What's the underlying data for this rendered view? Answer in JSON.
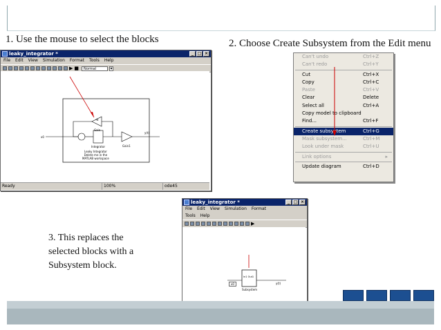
{
  "steps": {
    "step1": "1. Use the mouse to select the blocks",
    "step2": "2. Choose Create Subsystem from the Edit menu",
    "step3_line1": "3. This replaces the",
    "step3_line2": "selected blocks with a",
    "step3_line3": "Subsystem block."
  },
  "window1": {
    "title": "leaky_integrator *",
    "menu": [
      "File",
      "Edit",
      "View",
      "Simulation",
      "Format",
      "Tools",
      "Help"
    ],
    "sim_mode": "Normal",
    "status": {
      "left": "Ready",
      "zoom": "100%",
      "solver": "ode45"
    },
    "blocks": {
      "gain_value": "-K-",
      "gain_label": "Gain",
      "integrator_label": "Integrator",
      "gain1_label": "Gain1",
      "in_label": "x0",
      "out_label": "y(t)",
      "note_line1": "Leaky Integrator",
      "note_line2": "Delete me in the",
      "note_line3": "MATLAB workspace"
    }
  },
  "edit_menu": {
    "items": [
      {
        "label": "Can't undo",
        "shortcut": "Ctrl+Z",
        "state": "disabled"
      },
      {
        "label": "Can't redo",
        "shortcut": "Ctrl+Y",
        "state": "disabled"
      },
      {
        "sep": true
      },
      {
        "label": "Cut",
        "shortcut": "Ctrl+X",
        "state": "enabled"
      },
      {
        "label": "Copy",
        "shortcut": "Ctrl+C",
        "state": "enabled"
      },
      {
        "label": "Paste",
        "shortcut": "Ctrl+V",
        "state": "disabled"
      },
      {
        "label": "Clear",
        "shortcut": "Delete",
        "state": "enabled"
      },
      {
        "label": "Select all",
        "shortcut": "Ctrl+A",
        "state": "enabled"
      },
      {
        "label": "Copy model to clipboard",
        "shortcut": "",
        "state": "enabled"
      },
      {
        "label": "Find...",
        "shortcut": "Ctrl+F",
        "state": "enabled"
      },
      {
        "sep": true
      },
      {
        "label": "Create subsystem",
        "shortcut": "Ctrl+G",
        "state": "selected"
      },
      {
        "label": "Mask subsystem...",
        "shortcut": "Ctrl+M",
        "state": "disabled"
      },
      {
        "label": "Look under mask",
        "shortcut": "Ctrl+U",
        "state": "disabled"
      },
      {
        "sep": true
      },
      {
        "label": "Link options",
        "shortcut": "▸",
        "state": "disabled"
      },
      {
        "sep": true
      },
      {
        "label": "Update diagram",
        "shortcut": "Ctrl+D",
        "state": "enabled"
      }
    ]
  },
  "window2": {
    "title": "leaky_integrator *",
    "menu_row1": [
      "File",
      "Edit",
      "View",
      "Simulation",
      "Format"
    ],
    "menu_row2": [
      "Tools",
      "Help"
    ],
    "blocks": {
      "in_label": "x0",
      "subsystem_inner": "In1 Out1",
      "subsystem_label": "Subsystem",
      "out_label": "y(t)"
    }
  },
  "colors": {
    "title_bar": "#0a246a",
    "menu_highlight": "#0a246a",
    "arrow": "#cc0000",
    "footer": "#a9b7bd"
  }
}
